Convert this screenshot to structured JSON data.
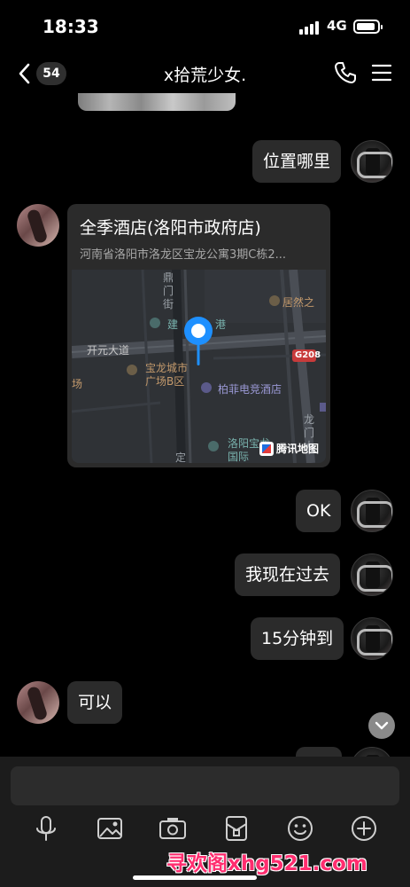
{
  "status_bar": {
    "time": "18:33",
    "network": "4G"
  },
  "nav": {
    "unread_count": "54",
    "title": "x拾荒少女."
  },
  "messages": {
    "m1_text": "位置哪里",
    "m2_location": {
      "name": "全季酒店(洛阳市政府店)",
      "address": "河南省洛阳市洛龙区宝龙公寓3期C栋2...",
      "map_labels": {
        "l1": "鼎",
        "l2": "门",
        "l3": "街",
        "l4": "居然之",
        "l5": "建",
        "l6": "港",
        "l7": "开元大道",
        "l8": "G208",
        "l9": "宝龙城市",
        "l10": "广场B区",
        "l11": "场",
        "l12": "柏菲电竞酒店",
        "l13": "龙",
        "l14": "门",
        "l15": "大",
        "l16": "洛阳宝龙",
        "l17": "国际",
        "l18": "定"
      },
      "map_brand": "腾讯地图"
    },
    "m3_text": "OK",
    "m4_text": "我现在过去",
    "m5_text": "15分钟到",
    "m6_text": "可以"
  },
  "footer": {
    "watermark": "寻欢阁xhg521.com"
  },
  "icons": {
    "back": "chevron-left-icon",
    "call": "phone-icon",
    "menu": "menu-icon",
    "voice": "microphone-icon",
    "image": "image-icon",
    "camera": "camera-icon",
    "red_packet": "red-packet-icon",
    "emoji": "emoji-icon",
    "more": "plus-circle-icon"
  },
  "colors": {
    "background": "#000000",
    "bubble": "#2b2b2b",
    "pin": "#1e90ff",
    "watermark": "#ff2d6f"
  }
}
